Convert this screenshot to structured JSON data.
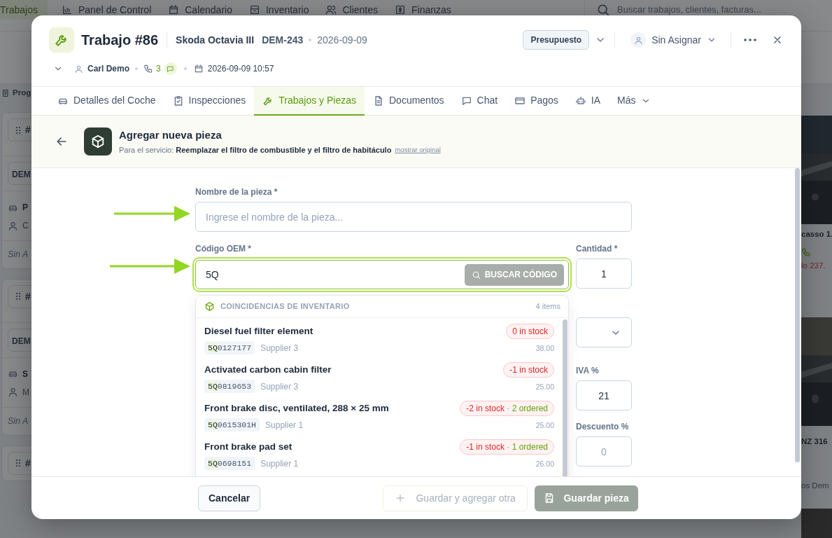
{
  "background": {
    "nav": [
      {
        "label": "Trabajos",
        "selected": true
      },
      {
        "label": "Panel de Control",
        "selected": false
      },
      {
        "label": "Calendario",
        "selected": false
      },
      {
        "label": "Inventario",
        "selected": false
      },
      {
        "label": "Clientes",
        "selected": false
      },
      {
        "label": "Finanzas",
        "selected": false
      }
    ],
    "search": {
      "placeholder": "Buscar trabajos, clientes, facturas..."
    },
    "left_column": {
      "title": "Prog",
      "cards": [
        {
          "handle": "#",
          "tag": "DEM",
          "title": "P",
          "owner": "C",
          "assignee": "Sin A"
        },
        {
          "handle": "#",
          "tag": "DEM",
          "title": "S",
          "owner": "M",
          "assignee": "Sin A"
        },
        {
          "handle": "#"
        }
      ]
    },
    "right_column": {
      "cards": [
        {
          "title": "casso 1.",
          "price": "lo 237."
        },
        {
          "title": "NZ 316",
          "footer": "os Dem"
        }
      ]
    }
  },
  "modal": {
    "header": {
      "title": "Trabajo #86",
      "vehicle": "Skoda Octavia III",
      "plate": "DEM-243",
      "date": "2026-09-09",
      "status": "Presupuesto",
      "assignee": "Sin Asignar",
      "customer": "Carl Demo",
      "phone_count": "3",
      "datetime": "2026-09-09 10:57"
    },
    "tabs": [
      {
        "label": "Detalles del Coche",
        "selected": false
      },
      {
        "label": "Inspecciones",
        "selected": false
      },
      {
        "label": "Trabajos y Piezas",
        "selected": true
      },
      {
        "label": "Documentos",
        "selected": false
      },
      {
        "label": "Chat",
        "selected": false
      },
      {
        "label": "Pagos",
        "selected": false
      },
      {
        "label": "IA",
        "selected": false
      },
      {
        "label": "Más",
        "selected": false
      }
    ],
    "panel": {
      "title": "Agregar nueva pieza",
      "subtitle": "Para el servicio: **Reemplazar el filtro de combustible y el filtro de habitáculo**",
      "link": "mostrar original"
    },
    "form": {
      "name": {
        "label": "Nombre de la pieza *",
        "placeholder": "Ingrese el nombre de la pieza..."
      },
      "oem": {
        "label": "Código OEM *",
        "value": "5Q",
        "focused": true,
        "search_button": {
          "label": "BUSCAR CÓDIGO",
          "disabled": true
        }
      },
      "quantity": {
        "label": "Cantidad *",
        "value": "1"
      },
      "vat": {
        "label": "IVA %",
        "value": "21"
      },
      "discount": {
        "label": "Descuento %",
        "placeholder": "0"
      }
    },
    "matches": {
      "title": "COINCIDENCIAS DE INVENTARIO",
      "count": "4 items",
      "items": [
        {
          "name": "Diesel fuel filter element",
          "code_match": "5Q",
          "code_rest": "0127177",
          "supplier": "Supplier 3",
          "stock": "0 in stock",
          "price": "38.00"
        },
        {
          "name": "Activated carbon cabin filter",
          "code_match": "5Q",
          "code_rest": "0819653",
          "supplier": "Supplier 3",
          "stock": "-1 in stock",
          "price": "25.00"
        },
        {
          "name": "Front brake disc, ventilated, 288 × 25 mm",
          "code_match": "5Q",
          "code_rest": "0615301H",
          "supplier": "Supplier 1",
          "stock": "-2 in stock",
          "ordered": "· 2 ordered",
          "price": "25.00"
        },
        {
          "name": "Front brake pad set",
          "code_match": "5Q",
          "code_rest": "0698151",
          "supplier": "Supplier 1",
          "stock": "-1 in stock",
          "ordered": "· 1 ordered",
          "price": "26.00"
        }
      ]
    },
    "footer": {
      "cancel": "Cancelar",
      "save_add": {
        "label": "Guardar y agregar otra",
        "disabled": true
      },
      "save": {
        "label": "Guardar pieza",
        "disabled": true
      }
    }
  }
}
